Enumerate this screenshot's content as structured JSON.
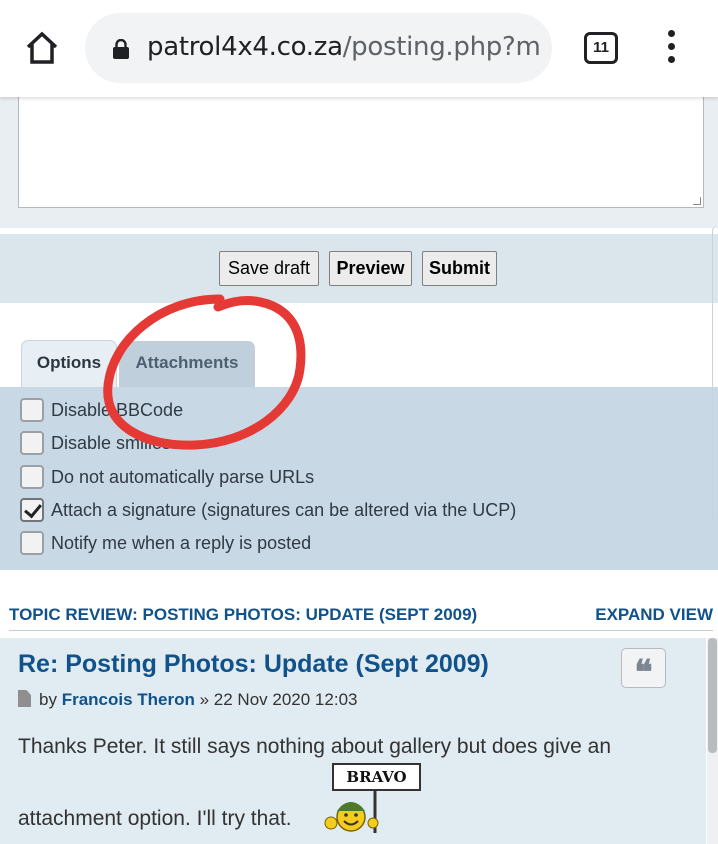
{
  "browser": {
    "url_host": "patrol4x4.co.za",
    "url_path": "/posting.php?m",
    "tab_count": "11"
  },
  "buttons": {
    "save_draft": "Save draft",
    "preview": "Preview",
    "submit": "Submit"
  },
  "tabs": [
    {
      "label": "Options",
      "active": true
    },
    {
      "label": "Attachments",
      "active": false
    }
  ],
  "options": [
    {
      "label": "Disable BBCode",
      "checked": false
    },
    {
      "label": "Disable smilies",
      "checked": false
    },
    {
      "label": "Do not automatically parse URLs",
      "checked": false
    },
    {
      "label": "Attach a signature (signatures can be altered via the UCP)",
      "checked": true
    },
    {
      "label": "Notify me when a reply is posted",
      "checked": false
    }
  ],
  "review": {
    "title": "TOPIC REVIEW: POSTING PHOTOS: UPDATE (SEPT 2009)",
    "expand": "EXPAND VIEW"
  },
  "post": {
    "title": "Re: Posting Photos: Update (Sept 2009)",
    "by": "by",
    "author": "Francois Theron",
    "date": "» 22 Nov 2020 12:03",
    "line1": "Thanks Peter. It still says nothing about gallery but does give an",
    "line2": "attachment option. I'll try that.",
    "smiley_sign": "BRAVO"
  },
  "colors": {
    "link": "#105289",
    "annotation": "#e53935",
    "panel": "#c9d8e5"
  }
}
